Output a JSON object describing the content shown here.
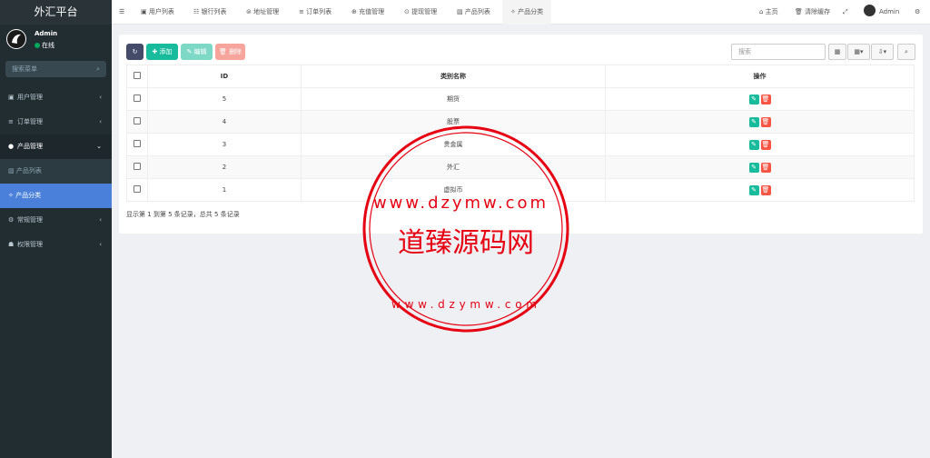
{
  "app": {
    "title": "外汇平台"
  },
  "user": {
    "name": "Admin",
    "status": "在线"
  },
  "sidebar": {
    "search_placeholder": "搜索菜单",
    "items": [
      {
        "label": "用户管理",
        "icon": "user-icon"
      },
      {
        "label": "订单管理",
        "icon": "list-icon"
      },
      {
        "label": "产品管理",
        "icon": "product-icon",
        "subitems": [
          "产品列表",
          "产品分类"
        ]
      },
      {
        "label": "常规管理",
        "icon": "cogs-icon"
      },
      {
        "label": "权限管理",
        "icon": "group-icon"
      }
    ]
  },
  "topbar": {
    "tabs": [
      "用户列表",
      "银行列表",
      "地址管理",
      "订单列表",
      "充值管理",
      "提现管理",
      "产品列表",
      "产品分类"
    ],
    "active_tab": "产品分类",
    "home": "主页",
    "clear_cache": "清除缓存",
    "admin": "Admin"
  },
  "toolbar": {
    "add": "添加",
    "edit": "编辑",
    "delete": "删除",
    "search_placeholder": "搜索"
  },
  "table": {
    "columns": [
      "ID",
      "类别名称",
      "操作"
    ],
    "rows": [
      {
        "id": "5",
        "name": "期货"
      },
      {
        "id": "4",
        "name": "股票"
      },
      {
        "id": "3",
        "name": "贵金属"
      },
      {
        "id": "2",
        "name": "外汇"
      },
      {
        "id": "1",
        "name": "虚拟币"
      }
    ]
  },
  "pagination": {
    "summary": "显示第 1 到第 5 条记录，总共 5 条记录"
  },
  "watermark": {
    "center_text": "道臻源码网",
    "ring_text": "www.dzymw.com"
  },
  "colors": {
    "sidebar": "#222d32",
    "active": "#4a80d9",
    "add": "#18bc9c",
    "delete": "#f75444",
    "stamp": "#e60012"
  }
}
